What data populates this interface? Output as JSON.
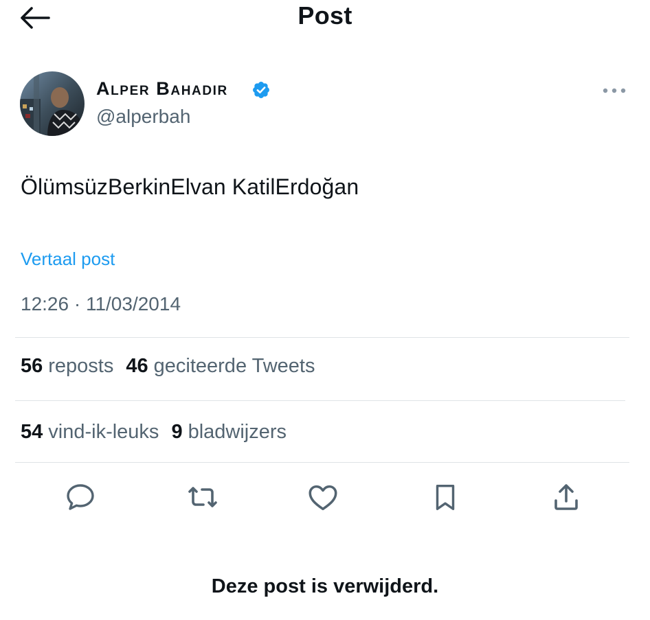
{
  "header": {
    "back_icon": "arrow-left-icon",
    "title": "Post"
  },
  "author": {
    "name": "Alper Bahadır",
    "handle": "@alperbah",
    "verified_icon": "verified-badge-icon",
    "verified_color": "#1d9bf0",
    "more_icon": "more-horizontal-icon"
  },
  "post": {
    "text": "ÖlümsüzBerkinElvan KatilErdoğan",
    "translate_label": "Vertaal post",
    "timestamp": "12:26 · 11/03/2014"
  },
  "stats": {
    "reposts_count": "56",
    "reposts_label": "reposts",
    "quotes_count": "46",
    "quotes_label": "geciteerde Tweets",
    "likes_count": "54",
    "likes_label": "vind-ik-leuks",
    "bookmarks_count": "9",
    "bookmarks_label": "bladwijzers"
  },
  "actions": [
    {
      "icon": "reply-icon"
    },
    {
      "icon": "repost-icon"
    },
    {
      "icon": "like-icon"
    },
    {
      "icon": "bookmark-icon"
    },
    {
      "icon": "share-icon"
    }
  ],
  "footer": {
    "deleted_message": "Deze post is verwijderd."
  },
  "colors": {
    "text_primary": "#0f1419",
    "text_secondary": "#536471",
    "link": "#1d9bf0",
    "divider": "#dfe3e6"
  }
}
